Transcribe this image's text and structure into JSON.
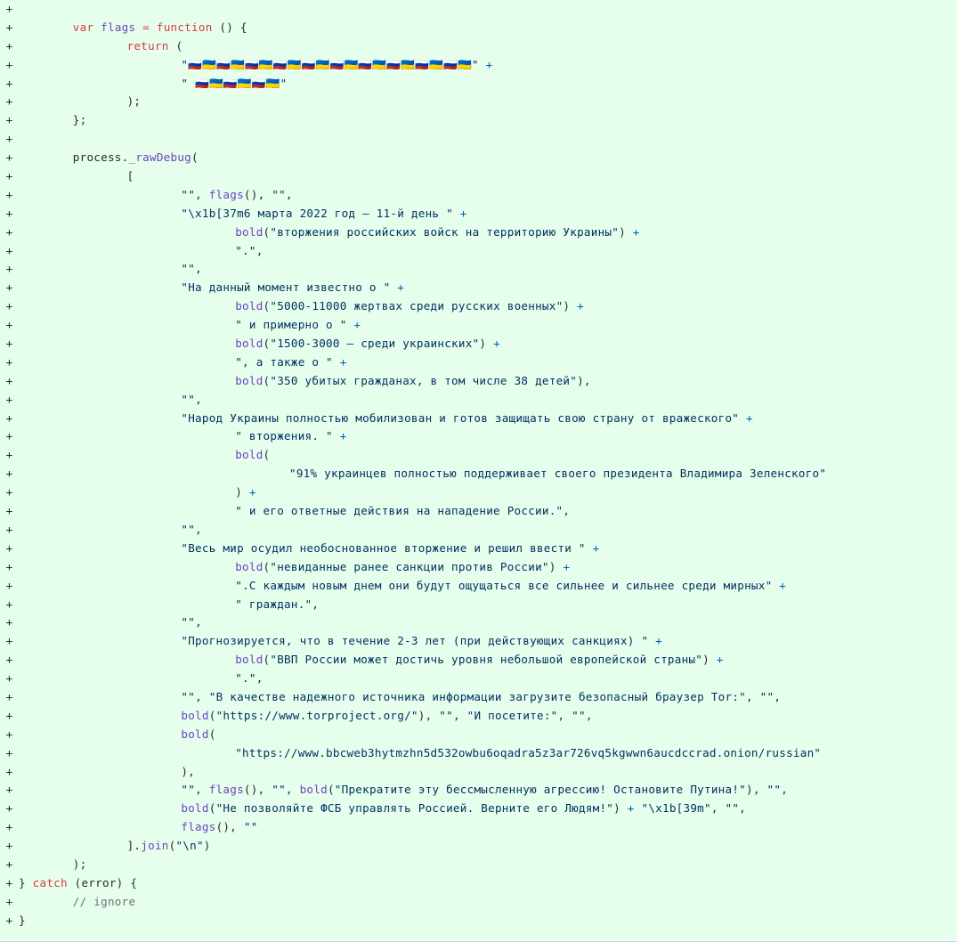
{
  "view": {
    "type": "code-diff",
    "mode": "addition",
    "marker": "+",
    "background_color": "#e6ffec",
    "text_color": "#24292f",
    "token_colors": {
      "keyword": "#d73a49",
      "function": "#6f42c1",
      "string": "#032f62",
      "operator": "#d73a49",
      "plus_operator": "#005cc5",
      "comment": "#6a737d"
    }
  },
  "flags": {
    "russia": "🇷🇺",
    "ukraine": "🇺🇦",
    "row1_sequence": "🇷🇺🇺🇦🇷🇺🇺🇦🇷🇺🇺🇦🇷🇺🇺🇦🇷🇺🇺🇦🇷🇺🇺🇦🇷🇺🇺🇦🇷🇺🇺🇦🇷🇺🇺🇦🇷🇺🇺🇦",
    "row2_sequence": "🇷🇺🇺🇦🇷🇺🇺🇦🇷🇺🇺🇦",
    "row1_count": 20,
    "row2_count": 6
  },
  "lines": [
    {
      "n": 1,
      "indent": 0,
      "tokens": []
    },
    {
      "n": 2,
      "indent": 8,
      "tokens": [
        {
          "t": "kw",
          "v": "var"
        },
        {
          "t": "pun",
          "v": " "
        },
        {
          "t": "fn",
          "v": "flags"
        },
        {
          "t": "pun",
          "v": " "
        },
        {
          "t": "op",
          "v": "="
        },
        {
          "t": "pun",
          "v": " "
        },
        {
          "t": "kw",
          "v": "function"
        },
        {
          "t": "pun",
          "v": " () {"
        }
      ]
    },
    {
      "n": 3,
      "indent": 16,
      "tokens": [
        {
          "t": "kw",
          "v": "return"
        },
        {
          "t": "pun",
          "v": " ("
        }
      ]
    },
    {
      "n": 4,
      "indent": 24,
      "tokens": [
        {
          "t": "str",
          "v": "\""
        },
        {
          "t": "flag",
          "v": "🇷🇺🇺🇦🇷🇺🇺🇦🇷🇺🇺🇦🇷🇺🇺🇦🇷🇺🇺🇦🇷🇺🇺🇦🇷🇺🇺🇦🇷🇺🇺🇦🇷🇺🇺🇦🇷🇺🇺🇦"
        },
        {
          "t": "str",
          "v": "\""
        },
        {
          "t": "pun",
          "v": " "
        },
        {
          "t": "pl",
          "v": "+"
        }
      ]
    },
    {
      "n": 5,
      "indent": 24,
      "tokens": [
        {
          "t": "str",
          "v": "\" "
        },
        {
          "t": "flag",
          "v": "🇷🇺🇺🇦🇷🇺🇺🇦🇷🇺🇺🇦"
        },
        {
          "t": "str",
          "v": "\""
        }
      ]
    },
    {
      "n": 6,
      "indent": 16,
      "tokens": [
        {
          "t": "pun",
          "v": ");"
        }
      ]
    },
    {
      "n": 7,
      "indent": 8,
      "tokens": [
        {
          "t": "pun",
          "v": "};"
        }
      ]
    },
    {
      "n": 8,
      "indent": 0,
      "tokens": []
    },
    {
      "n": 9,
      "indent": 8,
      "tokens": [
        {
          "t": "pun",
          "v": "process."
        },
        {
          "t": "fn",
          "v": "_rawDebug"
        },
        {
          "t": "pun",
          "v": "("
        }
      ]
    },
    {
      "n": 10,
      "indent": 16,
      "tokens": [
        {
          "t": "pun",
          "v": "["
        }
      ]
    },
    {
      "n": 11,
      "indent": 24,
      "tokens": [
        {
          "t": "str",
          "v": "\"\""
        },
        {
          "t": "pun",
          "v": ", "
        },
        {
          "t": "fn",
          "v": "flags"
        },
        {
          "t": "pun",
          "v": "(), "
        },
        {
          "t": "str",
          "v": "\"\""
        },
        {
          "t": "pun",
          "v": ","
        }
      ]
    },
    {
      "n": 12,
      "indent": 24,
      "tokens": [
        {
          "t": "str",
          "v": "\"\\x1b[37m6 марта 2022 год — 11-й день \""
        },
        {
          "t": "pun",
          "v": " "
        },
        {
          "t": "pl",
          "v": "+"
        }
      ]
    },
    {
      "n": 13,
      "indent": 32,
      "tokens": [
        {
          "t": "fn",
          "v": "bold"
        },
        {
          "t": "pun",
          "v": "("
        },
        {
          "t": "str",
          "v": "\"вторжения российских войск на территорию Украины\""
        },
        {
          "t": "pun",
          "v": ")"
        },
        {
          "t": "pun",
          "v": " "
        },
        {
          "t": "pl",
          "v": "+"
        }
      ]
    },
    {
      "n": 14,
      "indent": 32,
      "tokens": [
        {
          "t": "str",
          "v": "\".\""
        },
        {
          "t": "pun",
          "v": ","
        }
      ]
    },
    {
      "n": 15,
      "indent": 24,
      "tokens": [
        {
          "t": "str",
          "v": "\"\""
        },
        {
          "t": "pun",
          "v": ","
        }
      ]
    },
    {
      "n": 16,
      "indent": 24,
      "tokens": [
        {
          "t": "str",
          "v": "\"На данный момент известно о \""
        },
        {
          "t": "pun",
          "v": " "
        },
        {
          "t": "pl",
          "v": "+"
        }
      ]
    },
    {
      "n": 17,
      "indent": 32,
      "tokens": [
        {
          "t": "fn",
          "v": "bold"
        },
        {
          "t": "pun",
          "v": "("
        },
        {
          "t": "str",
          "v": "\"5000-11000 жертвах среди русских военных\""
        },
        {
          "t": "pun",
          "v": ")"
        },
        {
          "t": "pun",
          "v": " "
        },
        {
          "t": "pl",
          "v": "+"
        }
      ]
    },
    {
      "n": 18,
      "indent": 32,
      "tokens": [
        {
          "t": "str",
          "v": "\" и примерно о \""
        },
        {
          "t": "pun",
          "v": " "
        },
        {
          "t": "pl",
          "v": "+"
        }
      ]
    },
    {
      "n": 19,
      "indent": 32,
      "tokens": [
        {
          "t": "fn",
          "v": "bold"
        },
        {
          "t": "pun",
          "v": "("
        },
        {
          "t": "str",
          "v": "\"1500-3000 — среди украинских\""
        },
        {
          "t": "pun",
          "v": ")"
        },
        {
          "t": "pun",
          "v": " "
        },
        {
          "t": "pl",
          "v": "+"
        }
      ]
    },
    {
      "n": 20,
      "indent": 32,
      "tokens": [
        {
          "t": "str",
          "v": "\", а также о \""
        },
        {
          "t": "pun",
          "v": " "
        },
        {
          "t": "pl",
          "v": "+"
        }
      ]
    },
    {
      "n": 21,
      "indent": 32,
      "tokens": [
        {
          "t": "fn",
          "v": "bold"
        },
        {
          "t": "pun",
          "v": "("
        },
        {
          "t": "str",
          "v": "\"350 убитых гражданах, в том числе 38 детей\""
        },
        {
          "t": "pun",
          "v": "),"
        }
      ]
    },
    {
      "n": 22,
      "indent": 24,
      "tokens": [
        {
          "t": "str",
          "v": "\"\""
        },
        {
          "t": "pun",
          "v": ","
        }
      ]
    },
    {
      "n": 23,
      "indent": 24,
      "tokens": [
        {
          "t": "str",
          "v": "\"Народ Украины полностью мобилизован и готов защищать свою страну от вражеского\""
        },
        {
          "t": "pun",
          "v": " "
        },
        {
          "t": "pl",
          "v": "+"
        }
      ]
    },
    {
      "n": 24,
      "indent": 32,
      "tokens": [
        {
          "t": "str",
          "v": "\" вторжения. \""
        },
        {
          "t": "pun",
          "v": " "
        },
        {
          "t": "pl",
          "v": "+"
        }
      ]
    },
    {
      "n": 25,
      "indent": 32,
      "tokens": [
        {
          "t": "fn",
          "v": "bold"
        },
        {
          "t": "pun",
          "v": "("
        }
      ]
    },
    {
      "n": 26,
      "indent": 40,
      "tokens": [
        {
          "t": "str",
          "v": "\"91% украинцев полностью поддерживает своего президента Владимира Зеленского\""
        }
      ]
    },
    {
      "n": 27,
      "indent": 32,
      "tokens": [
        {
          "t": "pun",
          "v": ")"
        },
        {
          "t": "pun",
          "v": " "
        },
        {
          "t": "pl",
          "v": "+"
        }
      ]
    },
    {
      "n": 28,
      "indent": 32,
      "tokens": [
        {
          "t": "str",
          "v": "\" и его ответные действия на нападение России.\""
        },
        {
          "t": "pun",
          "v": ","
        }
      ]
    },
    {
      "n": 29,
      "indent": 24,
      "tokens": [
        {
          "t": "str",
          "v": "\"\""
        },
        {
          "t": "pun",
          "v": ","
        }
      ]
    },
    {
      "n": 30,
      "indent": 24,
      "tokens": [
        {
          "t": "str",
          "v": "\"Весь мир осудил необоснованное вторжение и решил ввести \""
        },
        {
          "t": "pun",
          "v": " "
        },
        {
          "t": "pl",
          "v": "+"
        }
      ]
    },
    {
      "n": 31,
      "indent": 32,
      "tokens": [
        {
          "t": "fn",
          "v": "bold"
        },
        {
          "t": "pun",
          "v": "("
        },
        {
          "t": "str",
          "v": "\"невиданные ранее санкции против России\""
        },
        {
          "t": "pun",
          "v": ")"
        },
        {
          "t": "pun",
          "v": " "
        },
        {
          "t": "pl",
          "v": "+"
        }
      ]
    },
    {
      "n": 32,
      "indent": 32,
      "tokens": [
        {
          "t": "str",
          "v": "\".С каждым новым днем они будут ощущаться все сильнее и сильнее среди мирных\""
        },
        {
          "t": "pun",
          "v": " "
        },
        {
          "t": "pl",
          "v": "+"
        }
      ]
    },
    {
      "n": 33,
      "indent": 32,
      "tokens": [
        {
          "t": "str",
          "v": "\" граждан.\""
        },
        {
          "t": "pun",
          "v": ","
        }
      ]
    },
    {
      "n": 34,
      "indent": 24,
      "tokens": [
        {
          "t": "str",
          "v": "\"\""
        },
        {
          "t": "pun",
          "v": ","
        }
      ]
    },
    {
      "n": 35,
      "indent": 24,
      "tokens": [
        {
          "t": "str",
          "v": "\"Прогнозируется, что в течение 2-3 лет (при действующих санкциях) \""
        },
        {
          "t": "pun",
          "v": " "
        },
        {
          "t": "pl",
          "v": "+"
        }
      ]
    },
    {
      "n": 36,
      "indent": 32,
      "tokens": [
        {
          "t": "fn",
          "v": "bold"
        },
        {
          "t": "pun",
          "v": "("
        },
        {
          "t": "str",
          "v": "\"ВВП России может достичь уровня небольшой европейской страны\""
        },
        {
          "t": "pun",
          "v": ")"
        },
        {
          "t": "pun",
          "v": " "
        },
        {
          "t": "pl",
          "v": "+"
        }
      ]
    },
    {
      "n": 37,
      "indent": 32,
      "tokens": [
        {
          "t": "str",
          "v": "\".\""
        },
        {
          "t": "pun",
          "v": ","
        }
      ]
    },
    {
      "n": 38,
      "indent": 24,
      "tokens": [
        {
          "t": "str",
          "v": "\"\""
        },
        {
          "t": "pun",
          "v": ", "
        },
        {
          "t": "str",
          "v": "\"В качестве надежного источника информации загрузите безопасный браузер Tor:\""
        },
        {
          "t": "pun",
          "v": ", "
        },
        {
          "t": "str",
          "v": "\"\""
        },
        {
          "t": "pun",
          "v": ","
        }
      ]
    },
    {
      "n": 39,
      "indent": 24,
      "tokens": [
        {
          "t": "fn",
          "v": "bold"
        },
        {
          "t": "pun",
          "v": "("
        },
        {
          "t": "str",
          "v": "\"https://www.torproject.org/\""
        },
        {
          "t": "pun",
          "v": "), "
        },
        {
          "t": "str",
          "v": "\"\""
        },
        {
          "t": "pun",
          "v": ", "
        },
        {
          "t": "str",
          "v": "\"И посетите:\""
        },
        {
          "t": "pun",
          "v": ", "
        },
        {
          "t": "str",
          "v": "\"\""
        },
        {
          "t": "pun",
          "v": ","
        }
      ]
    },
    {
      "n": 40,
      "indent": 24,
      "tokens": [
        {
          "t": "fn",
          "v": "bold"
        },
        {
          "t": "pun",
          "v": "("
        }
      ]
    },
    {
      "n": 41,
      "indent": 32,
      "tokens": [
        {
          "t": "str",
          "v": "\"https://www.bbcweb3hytmzhn5d532owbu6oqadra5z3ar726vq5kgwwn6aucdccrad.onion/russian\""
        }
      ]
    },
    {
      "n": 42,
      "indent": 24,
      "tokens": [
        {
          "t": "pun",
          "v": "),"
        }
      ]
    },
    {
      "n": 43,
      "indent": 24,
      "tokens": [
        {
          "t": "str",
          "v": "\"\""
        },
        {
          "t": "pun",
          "v": ", "
        },
        {
          "t": "fn",
          "v": "flags"
        },
        {
          "t": "pun",
          "v": "(), "
        },
        {
          "t": "str",
          "v": "\"\""
        },
        {
          "t": "pun",
          "v": ", "
        },
        {
          "t": "fn",
          "v": "bold"
        },
        {
          "t": "pun",
          "v": "("
        },
        {
          "t": "str",
          "v": "\"Прекратите эту бессмысленную агрессию! Остановите Путина!\""
        },
        {
          "t": "pun",
          "v": "), "
        },
        {
          "t": "str",
          "v": "\"\""
        },
        {
          "t": "pun",
          "v": ","
        }
      ]
    },
    {
      "n": 44,
      "indent": 24,
      "tokens": [
        {
          "t": "fn",
          "v": "bold"
        },
        {
          "t": "pun",
          "v": "("
        },
        {
          "t": "str",
          "v": "\"Не позволяйте ФСБ управлять Россией. Верните его Людям!\""
        },
        {
          "t": "pun",
          "v": ") "
        },
        {
          "t": "pl",
          "v": "+"
        },
        {
          "t": "pun",
          "v": " "
        },
        {
          "t": "str",
          "v": "\"\\x1b[39m\""
        },
        {
          "t": "pun",
          "v": ", "
        },
        {
          "t": "str",
          "v": "\"\""
        },
        {
          "t": "pun",
          "v": ","
        }
      ]
    },
    {
      "n": 45,
      "indent": 24,
      "tokens": [
        {
          "t": "fn",
          "v": "flags"
        },
        {
          "t": "pun",
          "v": "(), "
        },
        {
          "t": "str",
          "v": "\"\""
        }
      ]
    },
    {
      "n": 46,
      "indent": 16,
      "tokens": [
        {
          "t": "pun",
          "v": "]."
        },
        {
          "t": "fn",
          "v": "join"
        },
        {
          "t": "pun",
          "v": "("
        },
        {
          "t": "str",
          "v": "\"\\n\""
        },
        {
          "t": "pun",
          "v": ")"
        }
      ]
    },
    {
      "n": 47,
      "indent": 8,
      "tokens": [
        {
          "t": "pun",
          "v": ");"
        }
      ]
    },
    {
      "n": 48,
      "indent": 0,
      "tokens": [
        {
          "t": "pun",
          "v": "} "
        },
        {
          "t": "kw",
          "v": "catch"
        },
        {
          "t": "pun",
          "v": " (error) {"
        }
      ]
    },
    {
      "n": 49,
      "indent": 8,
      "tokens": [
        {
          "t": "cmt",
          "v": "// ignore"
        }
      ]
    },
    {
      "n": 50,
      "indent": 0,
      "tokens": [
        {
          "t": "pun",
          "v": "}"
        }
      ]
    }
  ]
}
